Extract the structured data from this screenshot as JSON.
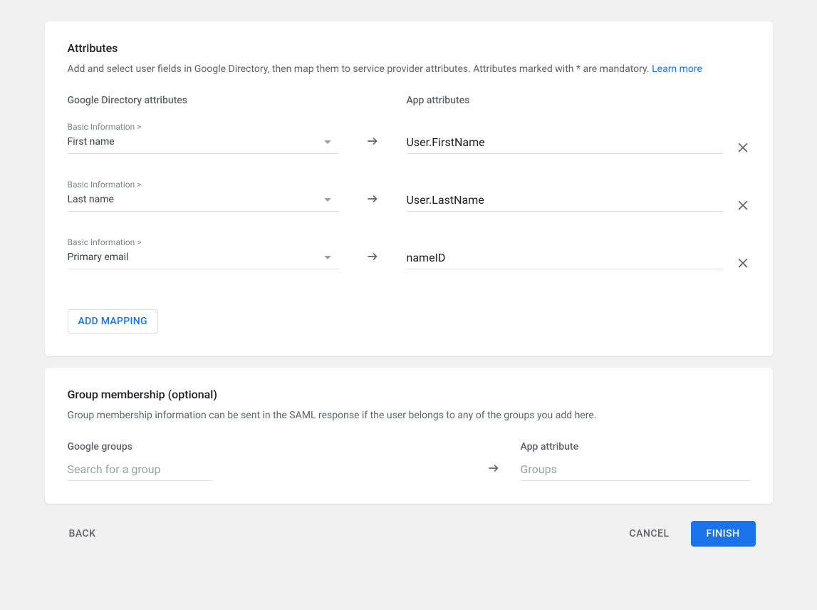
{
  "attributes": {
    "title": "Attributes",
    "description": "Add and select user fields in Google Directory, then map them to service provider attributes. Attributes marked with * are mandatory.",
    "learn_more": "Learn more",
    "left_col_header": "Google Directory attributes",
    "right_col_header": "App attributes",
    "mappings": [
      {
        "category": "Basic Information >",
        "field": "First name",
        "app_attr": "User.FirstName"
      },
      {
        "category": "Basic Information >",
        "field": "Last name",
        "app_attr": "User.LastName"
      },
      {
        "category": "Basic Information >",
        "field": "Primary email",
        "app_attr": "nameID"
      }
    ],
    "add_mapping_label": "ADD MAPPING"
  },
  "groups": {
    "title": "Group membership (optional)",
    "description": "Group membership information can be sent in the SAML response if the user belongs to any of the groups you add here.",
    "left_col_header": "Google groups",
    "right_col_header": "App attribute",
    "search_placeholder": "Search for a group",
    "app_attr_value": "Groups"
  },
  "footer": {
    "back": "BACK",
    "cancel": "CANCEL",
    "finish": "FINISH"
  }
}
